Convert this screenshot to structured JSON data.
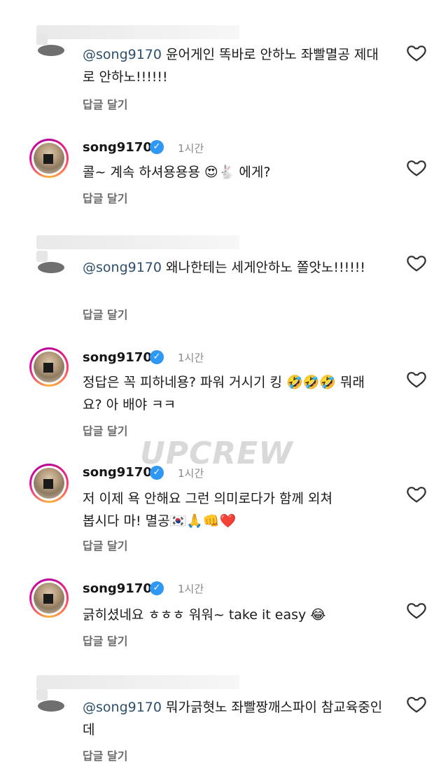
{
  "watermark": "UPCREW",
  "reply_label": "답글 달기",
  "comments": [
    {
      "type": "anon",
      "mention": "@song9170",
      "text": " 윤어게인 똑바로 안하노 좌빨멸공 제대로 안하노!!!!!!"
    },
    {
      "type": "owner",
      "username": "song9170",
      "time": "1시간",
      "text": "콜~ 계속 하셔용용용 😍🐇 에게?"
    },
    {
      "type": "anon",
      "mention": "@song9170",
      "text": " 왜나한테는 세게안하노 쫄앗노!!!!!!"
    },
    {
      "type": "owner",
      "username": "song9170",
      "time": "1시간",
      "text": "정답은 꼭 피하네용? 파워 거시기 킹 🤣🤣🤣 뭐래요? 아 배야 ㅋㅋ"
    },
    {
      "type": "owner",
      "username": "song9170",
      "time": "1시간",
      "text": "저 이제 욕 안해요 그런 의미로다가 함께 외쳐봅시다 마! 멸공🇰🇷🙏👊❤️"
    },
    {
      "type": "owner",
      "username": "song9170",
      "time": "1시간",
      "text": "긁히셨네요 ㅎㅎㅎ 워워~ take it easy 😂"
    },
    {
      "type": "anon",
      "mention": "@song9170",
      "text": " 뭐가긁혓노 좌빨짱깨스파이 참교육중인데"
    }
  ]
}
